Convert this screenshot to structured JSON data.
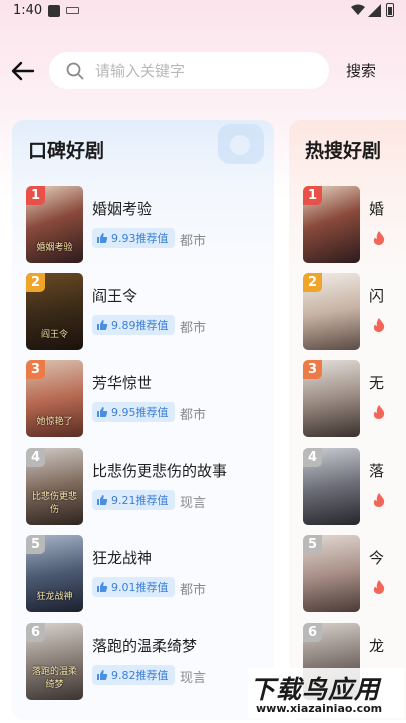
{
  "status_bar": {
    "time": "1:40"
  },
  "search": {
    "placeholder": "请输入关键字",
    "value": "",
    "button_label": "搜索"
  },
  "boards": {
    "praise": {
      "title": "口碑好剧",
      "items": [
        {
          "rank": "1",
          "title": "婚姻考验",
          "score": "9.93推荐值",
          "genre": "都市",
          "poster_text": "婚姻考验"
        },
        {
          "rank": "2",
          "title": "阎王令",
          "score": "9.89推荐值",
          "genre": "都市",
          "poster_text": "阎王令"
        },
        {
          "rank": "3",
          "title": "芳华惊世",
          "score": "9.95推荐值",
          "genre": "都市",
          "poster_text": "她惊艳了"
        },
        {
          "rank": "4",
          "title": "比悲伤更悲伤的故事",
          "score": "9.21推荐值",
          "genre": "现言",
          "poster_text": "比悲伤更悲伤"
        },
        {
          "rank": "5",
          "title": "狂龙战神",
          "score": "9.01推荐值",
          "genre": "都市",
          "poster_text": "狂龙战神"
        },
        {
          "rank": "6",
          "title": "落跑的温柔绮梦",
          "score": "9.82推荐值",
          "genre": "现言",
          "poster_text": "落跑的温柔绮梦"
        }
      ]
    },
    "hot": {
      "title": "热搜好剧",
      "items": [
        {
          "rank": "1",
          "title": "婚"
        },
        {
          "rank": "2",
          "title": "闪"
        },
        {
          "rank": "3",
          "title": "无"
        },
        {
          "rank": "4",
          "title": "落"
        },
        {
          "rank": "5",
          "title": "今"
        },
        {
          "rank": "6",
          "title": "龙"
        }
      ]
    }
  },
  "watermark": {
    "main": "下载鸟应用",
    "url": "www.xiazainiao.com"
  },
  "colors": {
    "rank_1": "#e8514a",
    "rank_2": "#efa52a",
    "rank_3": "#ec7b48",
    "rank_other": "#b9b9b9",
    "tag_text": "#3d7fd6",
    "tag_bg": "#dcecfc",
    "fire": "#f2665a"
  }
}
